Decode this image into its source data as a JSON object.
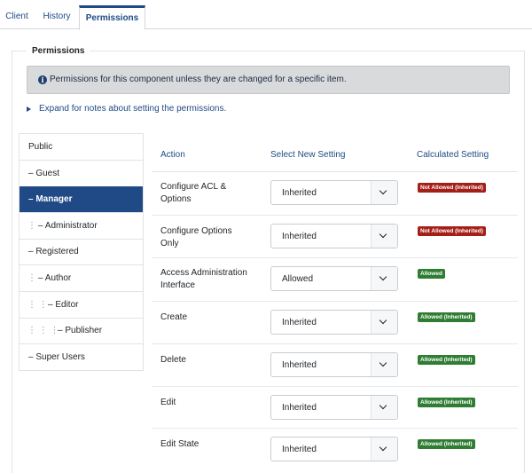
{
  "tabs": [
    {
      "label": "Client",
      "active": false
    },
    {
      "label": "History",
      "active": false
    },
    {
      "label": "Permissions",
      "active": true
    }
  ],
  "fieldset": {
    "legend": "Permissions"
  },
  "alert": {
    "text": "Permissions for this component unless they are changed for a specific item."
  },
  "expand": {
    "text": "Expand for notes about setting the permissions."
  },
  "groups": [
    {
      "label": "Public",
      "level": 0,
      "prefix": ""
    },
    {
      "label": "Guest",
      "level": 0,
      "prefix": "– "
    },
    {
      "label": "Manager",
      "level": 0,
      "prefix": "– ",
      "active": true
    },
    {
      "label": "Administrator",
      "level": 1,
      "prefix": "– "
    },
    {
      "label": "Registered",
      "level": 0,
      "prefix": "– "
    },
    {
      "label": "Author",
      "level": 1,
      "prefix": "– "
    },
    {
      "label": "Editor",
      "level": 2,
      "prefix": "– "
    },
    {
      "label": "Publisher",
      "level": 3,
      "prefix": "– "
    },
    {
      "label": "Super Users",
      "level": 0,
      "prefix": "– "
    }
  ],
  "table": {
    "headers": {
      "action": "Action",
      "select": "Select New Setting",
      "calculated": "Calculated Setting"
    },
    "rows": [
      {
        "action": "Configure ACL & Options",
        "value": "Inherited",
        "calculated": "Not Allowed (Inherited)",
        "status": "deny"
      },
      {
        "action": "Configure Options Only",
        "value": "Inherited",
        "calculated": "Not Allowed (Inherited)",
        "status": "deny"
      },
      {
        "action": "Access Administration Interface",
        "value": "Allowed",
        "calculated": "Allowed",
        "status": "allow"
      },
      {
        "action": "Create",
        "value": "Inherited",
        "calculated": "Allowed (Inherited)",
        "status": "allow"
      },
      {
        "action": "Delete",
        "value": "Inherited",
        "calculated": "Allowed (Inherited)",
        "status": "allow"
      },
      {
        "action": "Edit",
        "value": "Inherited",
        "calculated": "Allowed (Inherited)",
        "status": "allow"
      },
      {
        "action": "Edit State",
        "value": "Inherited",
        "calculated": "Allowed (Inherited)",
        "status": "allow"
      }
    ]
  },
  "colors": {
    "accent": "#1f4a86",
    "deny": "#a51f18",
    "allow": "#2f7d32"
  }
}
